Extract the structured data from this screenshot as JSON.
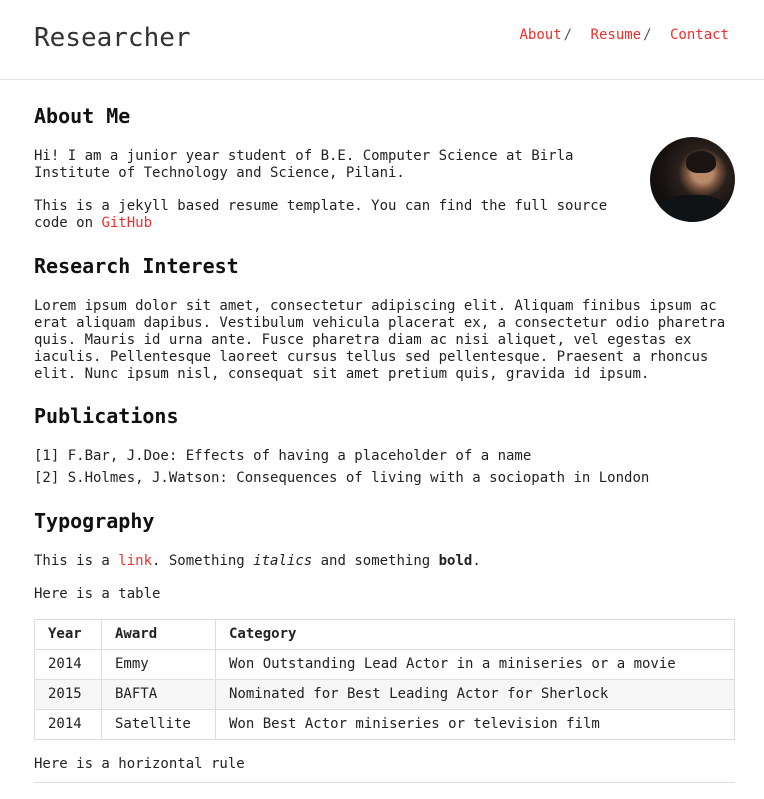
{
  "site": {
    "title": "Researcher",
    "nav": [
      {
        "label": "About"
      },
      {
        "label": "Resume"
      },
      {
        "label": "Contact"
      }
    ],
    "nav_separator": "/"
  },
  "about": {
    "heading": "About Me",
    "para1": "Hi! I am a junior year student of B.E. Computer Science at Birla Institute of Technology and Science, Pilani.",
    "para2_prefix": "This is a jekyll based resume template. You can find the full source code on ",
    "para2_link": "GitHub"
  },
  "research": {
    "heading": "Research Interest",
    "text": "Lorem ipsum dolor sit amet, consectetur adipiscing elit. Aliquam finibus ipsum ac erat aliquam dapibus. Vestibulum vehicula placerat ex, a consectetur odio pharetra quis. Mauris id urna ante. Fusce pharetra diam ac nisi aliquet, vel egestas ex iaculis. Pellentesque laoreet cursus tellus sed pellentesque. Praesent a rhoncus elit. Nunc ipsum nisl, consequat sit amet pretium quis, gravida id ipsum."
  },
  "publications": {
    "heading": "Publications",
    "items": [
      "[1] F.Bar, J.Doe: Effects of having a placeholder of a name",
      "[2] S.Holmes, J.Watson: Consequences of living with a sociopath in London"
    ]
  },
  "typography": {
    "heading": "Typography",
    "line_prefix": "This is a ",
    "link": "link",
    "line_mid1": ". Something ",
    "italic": "italics",
    "line_mid2": " and something ",
    "bold": "bold",
    "line_end": ".",
    "table_intro": "Here is a table",
    "table": {
      "headers": [
        "Year",
        "Award",
        "Category"
      ],
      "rows": [
        [
          "2014",
          "Emmy",
          "Won Outstanding Lead Actor in a miniseries or a movie"
        ],
        [
          "2015",
          "BAFTA",
          "Nominated for Best Leading Actor for Sherlock"
        ],
        [
          "2014",
          "Satellite",
          "Won Best Actor miniseries or television film"
        ]
      ]
    },
    "rule_intro": "Here is a horizontal rule"
  },
  "colors": {
    "accent": "#e8312f",
    "text": "#222222",
    "border": "#dddddd"
  }
}
